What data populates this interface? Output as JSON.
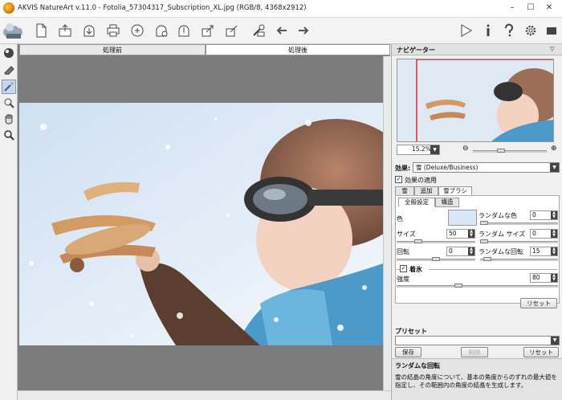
{
  "window": {
    "title": "AKVIS NatureArt v.11.0 - Fotolia_57304317_Subscription_XL.jpg (RGB/8, 4368x2912)"
  },
  "toolbar": {
    "icons": [
      "logo-icon",
      "new-icon",
      "open-icon",
      "save-icon",
      "print-icon",
      "share-icon",
      "batch-icon",
      "import-icon",
      "export-icon",
      "export-alt-icon",
      "settings-wrench-icon",
      "undo-icon",
      "redo-icon",
      "run-icon",
      "info-icon",
      "help-icon",
      "gear-icon",
      "notifications-icon"
    ]
  },
  "canvas": {
    "tab_before": "処理前",
    "tab_after": "処理後"
  },
  "navigator": {
    "title": "ナビゲーター",
    "zoom": "15.2%"
  },
  "effect": {
    "label": "効果:",
    "value": "雪 (Deluxe/Business)",
    "apply_label": "効果の適用",
    "tabs": [
      "雪",
      "追加",
      "雪ブラシ"
    ],
    "subtabs": [
      "全般設定",
      "構造"
    ]
  },
  "params": {
    "color_label": "色",
    "random_color_label": "ランダムな色",
    "random_color_value": "0",
    "size_label": "サイズ",
    "size_value": "50",
    "random_size_label": "ランダム サイズ",
    "random_size_value": "0",
    "rotation_label": "回転",
    "rotation_value": "0",
    "random_rotation_label": "ランダムな回転",
    "random_rotation_value": "15",
    "icing_label": "着氷",
    "strength_label": "強度",
    "strength_value": "80",
    "reset_label": "リセット"
  },
  "preset": {
    "label": "プリセット",
    "value": "",
    "save": "保存",
    "delete": "削除",
    "reset": "リセット"
  },
  "hint": {
    "title": "ランダムな回転",
    "text": "雪の結晶の角度について、基本の角度からのずれの最大値を指定し、その範囲内の角度の結晶を生成します。"
  },
  "colors": {
    "accent": "#dc2b2b",
    "snow_color": "#d8e8f8"
  }
}
